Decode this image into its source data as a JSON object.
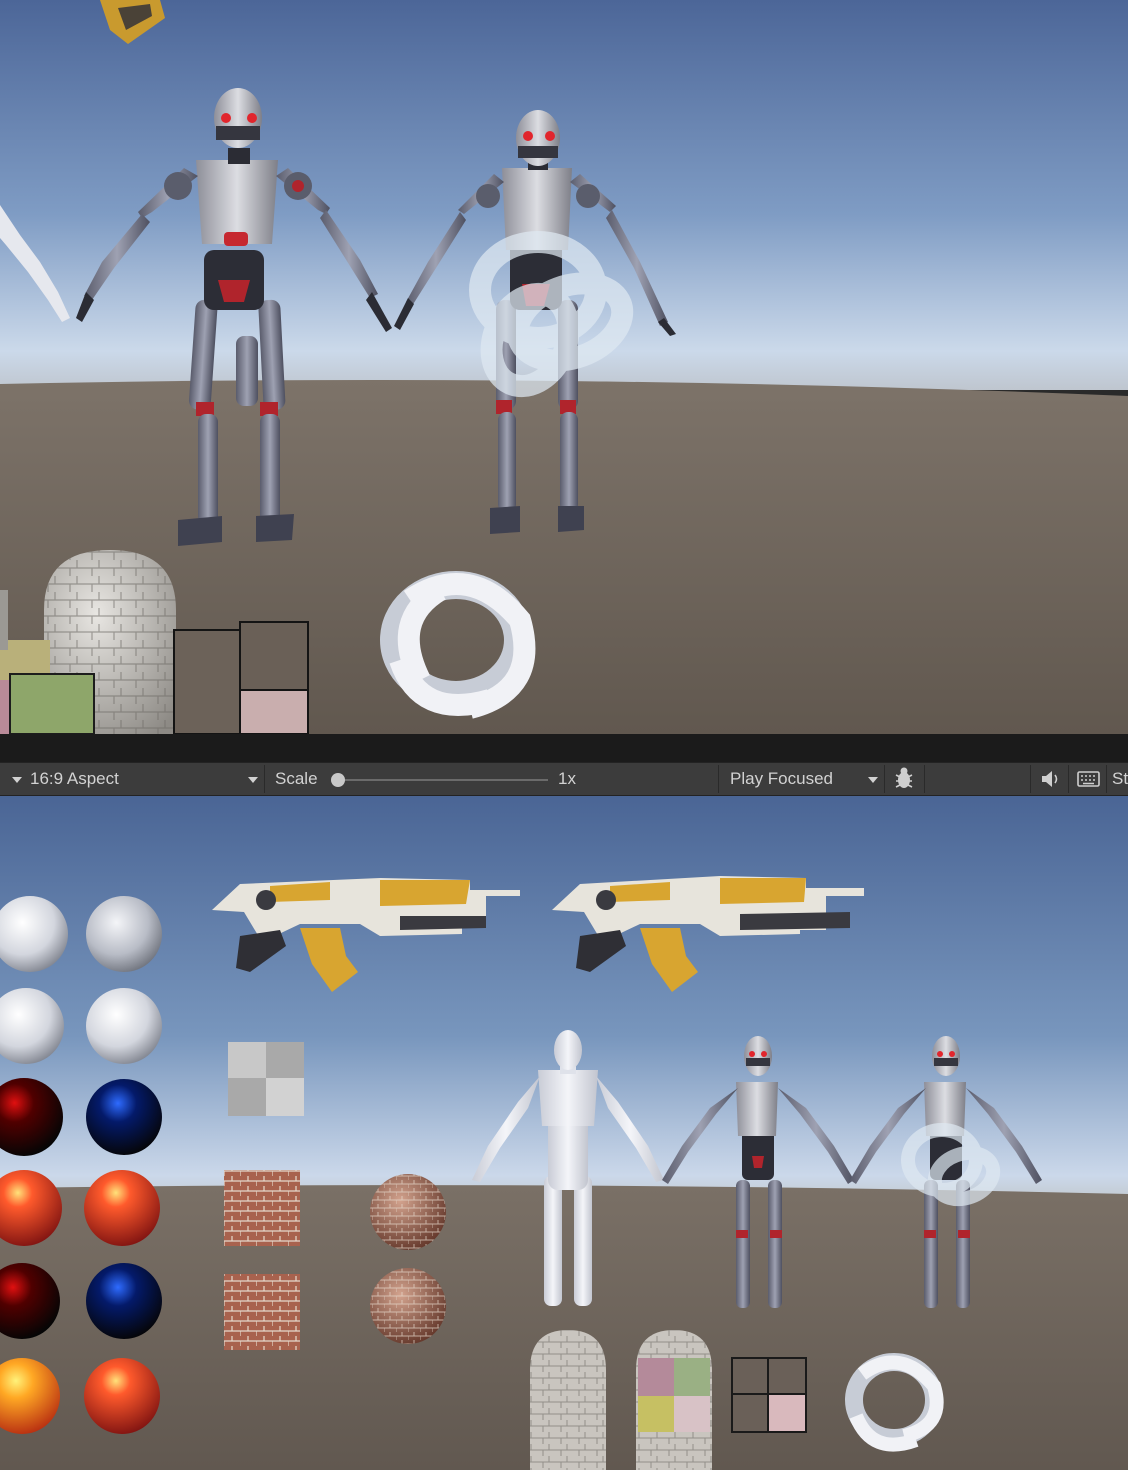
{
  "game_toolbar": {
    "aspect_label": "16:9 Aspect",
    "scale_label": "Scale",
    "scale_value": "1x",
    "scale_level": 0,
    "play_mode_label": "Play Focused",
    "stats_label_partial": "St",
    "icons": [
      "dropdown-arrow-icon",
      "bug-icon",
      "speaker-icon",
      "keyboard-icon"
    ]
  },
  "colors": {
    "sky_top": "#4f6c9c",
    "sky_horizon": "#c9d8ec",
    "ground": "#6a6058",
    "toolbar_bg": "#3c3c3c",
    "separator": "#1b1b1b",
    "toolbar_text": "#d2d2d2"
  }
}
